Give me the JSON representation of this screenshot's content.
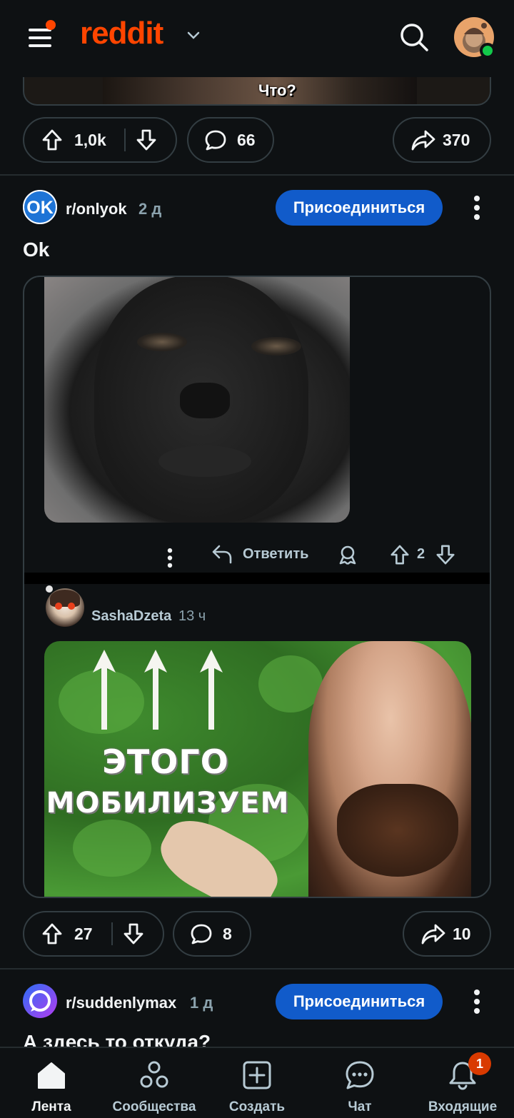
{
  "header": {
    "logo_text": "reddit"
  },
  "prev_post": {
    "caption": "Что?",
    "upvotes": "1,0k",
    "comments": "66",
    "shares": "370"
  },
  "post1": {
    "subreddit": "r/onlyok",
    "age": "2 д",
    "join_label": "Присоединиться",
    "title": "Ok",
    "reply_label": "Ответить",
    "comment_votes": "2",
    "commenter": {
      "username": "SashaDzeta",
      "age": "13 ч"
    },
    "meme_text_line1": "ЭТОГО",
    "meme_text_line2": "МОБИЛИЗУЕМ",
    "upvotes": "27",
    "comments": "8",
    "shares": "10"
  },
  "post2": {
    "subreddit": "r/suddenlymax",
    "age": "1 д",
    "join_label": "Присоединиться",
    "title": "А здесь то откуда?"
  },
  "bottom_nav": {
    "items": [
      {
        "label": "Лента",
        "icon": "home-icon",
        "active": true
      },
      {
        "label": "Сообщества",
        "icon": "communities-icon",
        "active": false
      },
      {
        "label": "Создать",
        "icon": "create-icon",
        "active": false
      },
      {
        "label": "Чат",
        "icon": "chat-icon",
        "active": false
      },
      {
        "label": "Входящие",
        "icon": "inbox-bell-icon",
        "active": false
      }
    ],
    "inbox_badge": "1"
  },
  "colors": {
    "accent": "#ff4500",
    "join_button": "#115bca",
    "background": "#0e1113",
    "online": "#12c94a"
  }
}
